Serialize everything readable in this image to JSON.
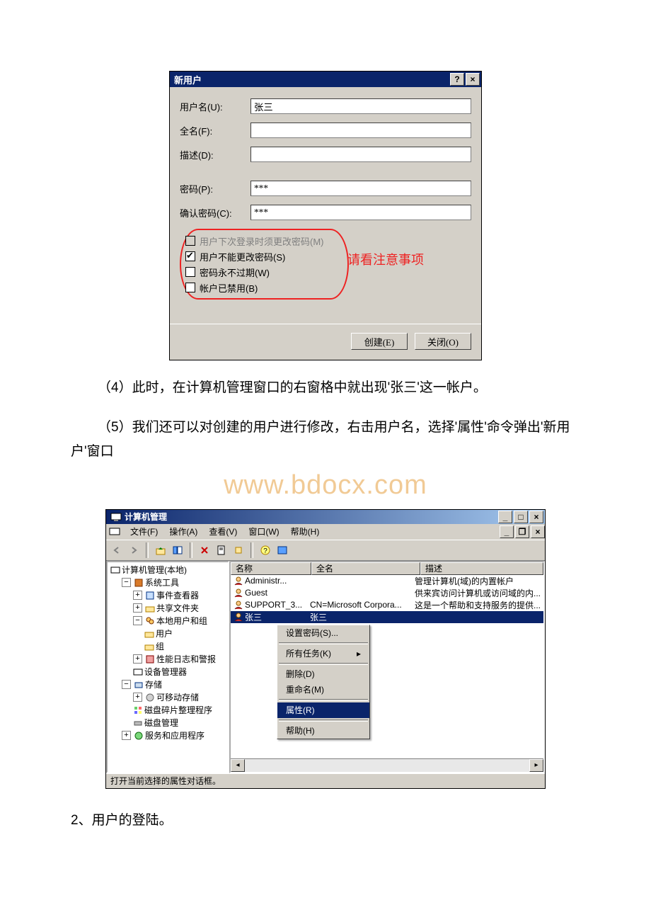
{
  "dialog": {
    "title": "新用户",
    "fields": {
      "username_label": "用户名(U):",
      "username_value": "张三",
      "fullname_label": "全名(F):",
      "fullname_value": "",
      "description_label": "描述(D):",
      "description_value": "",
      "password_label": "密码(P):",
      "password_value": "***",
      "confirm_label": "确认密码(C):",
      "confirm_value": "***"
    },
    "checks": {
      "must_change": {
        "label": "用户下次登录时须更改密码(M)",
        "checked": false,
        "disabled": true
      },
      "cannot_change": {
        "label": "用户不能更改密码(S)",
        "checked": true,
        "disabled": false
      },
      "never_expire": {
        "label": "密码永不过期(W)",
        "checked": false,
        "disabled": false
      },
      "disabled_acct": {
        "label": "帐户已禁用(B)",
        "checked": false,
        "disabled": false
      }
    },
    "annotation": "请看注意事项",
    "buttons": {
      "create": "创建(E)",
      "close": "关闭(O)"
    }
  },
  "body": {
    "p4": "（4）此时，在计算机管理窗口的右窗格中就出现'张三'这一帐户。",
    "p5a": "（5）我们还可以对创建的用户进行修改，右击用户名，选择'属性'命令弹出'新用户'窗口",
    "watermark": "www.bdocx.com",
    "p6": "2、用户的登陆。"
  },
  "mmc": {
    "title": "计算机管理",
    "menu": {
      "file": "文件(F)",
      "action": "操作(A)",
      "view": "查看(V)",
      "window": "窗口(W)",
      "help": "帮助(H)"
    },
    "tree": {
      "root": "计算机管理(本地)",
      "n1": "系统工具",
      "n1a": "事件查看器",
      "n1b": "共享文件夹",
      "n1c": "本地用户和组",
      "n1c1": "用户",
      "n1c2": "组",
      "n1d": "性能日志和警报",
      "n1e": "设备管理器",
      "n2": "存储",
      "n2a": "可移动存储",
      "n2b": "磁盘碎片整理程序",
      "n2c": "磁盘管理",
      "n3": "服务和应用程序"
    },
    "columns": {
      "name": "名称",
      "fullname": "全名",
      "desc": "描述"
    },
    "col_widths": {
      "name": 100,
      "fullname": 140,
      "desc": 180
    },
    "rows": [
      {
        "name": "Administr...",
        "fullname": "",
        "desc": "管理计算机(域)的内置帐户"
      },
      {
        "name": "Guest",
        "fullname": "",
        "desc": "供来宾访问计算机或访问域的内..."
      },
      {
        "name": "SUPPORT_3...",
        "fullname": "CN=Microsoft Corpora...",
        "desc": "这是一个帮助和支持服务的提供..."
      },
      {
        "name": "张三",
        "fullname": "张三",
        "desc": ""
      }
    ],
    "context_menu": {
      "set_password": "设置密码(S)...",
      "all_tasks": "所有任务(K)",
      "delete": "删除(D)",
      "rename": "重命名(M)",
      "properties": "属性(R)",
      "help": "帮助(H)"
    },
    "statusbar": "打开当前选择的属性对话框。"
  }
}
